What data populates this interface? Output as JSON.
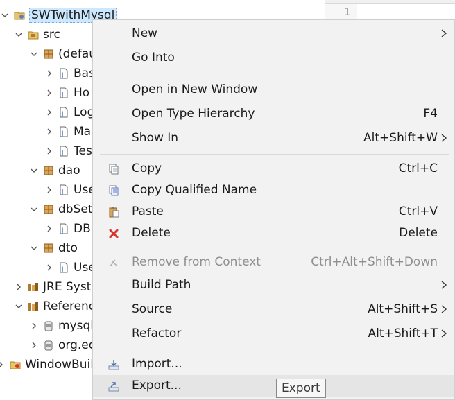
{
  "tree": {
    "project": "SWTwithMysql",
    "src": "src",
    "default_pkg": "(defau",
    "default_children": [
      "Bas",
      "Ho",
      "Log",
      "Ma",
      "Tes"
    ],
    "dao": "dao",
    "dao_children": [
      "Use"
    ],
    "dbset": "dbSet",
    "dbset_children": [
      "DB"
    ],
    "dto": "dto",
    "dto_children": [
      "Use"
    ],
    "jre": "JRE Syste",
    "references": "Referenc",
    "ref_children": [
      "mysql",
      "org.ec"
    ],
    "windowbuilder": "WindowBuil"
  },
  "editor": {
    "line_number": "1"
  },
  "context_menu": {
    "items": [
      {
        "label": "New",
        "shortcut": "",
        "submenu": true,
        "icon": ""
      },
      {
        "label": "Go Into",
        "shortcut": "",
        "submenu": false,
        "icon": ""
      },
      {
        "label": "Open in New Window",
        "shortcut": "",
        "submenu": false,
        "icon": ""
      },
      {
        "label": "Open Type Hierarchy",
        "shortcut": "F4",
        "submenu": false,
        "icon": ""
      },
      {
        "label": "Show In",
        "shortcut": "Alt+Shift+W",
        "submenu": true,
        "icon": ""
      },
      {
        "label": "Copy",
        "shortcut": "Ctrl+C",
        "submenu": false,
        "icon": "copy-icon"
      },
      {
        "label": "Copy Qualified Name",
        "shortcut": "",
        "submenu": false,
        "icon": "copy-qualified-name-icon"
      },
      {
        "label": "Paste",
        "shortcut": "Ctrl+V",
        "submenu": false,
        "icon": "paste-icon"
      },
      {
        "label": "Delete",
        "shortcut": "Delete",
        "submenu": false,
        "icon": "delete-icon"
      },
      {
        "label": "Remove from Context",
        "shortcut": "Ctrl+Alt+Shift+Down",
        "submenu": false,
        "icon": "remove-context-icon",
        "disabled": true
      },
      {
        "label": "Build Path",
        "shortcut": "",
        "submenu": true,
        "icon": ""
      },
      {
        "label": "Source",
        "shortcut": "Alt+Shift+S",
        "submenu": true,
        "icon": ""
      },
      {
        "label": "Refactor",
        "shortcut": "Alt+Shift+T",
        "submenu": true,
        "icon": ""
      },
      {
        "label": "Import...",
        "shortcut": "",
        "submenu": false,
        "icon": "import-icon"
      },
      {
        "label": "Export...",
        "shortcut": "",
        "submenu": false,
        "icon": "export-icon"
      }
    ]
  },
  "tooltip": {
    "text": "Export"
  },
  "colors": {
    "selection": "#cce8ff",
    "menu_bg": "#f2f2f2",
    "delete_red": "#d9342b",
    "package_brown": "#b07a2c"
  }
}
